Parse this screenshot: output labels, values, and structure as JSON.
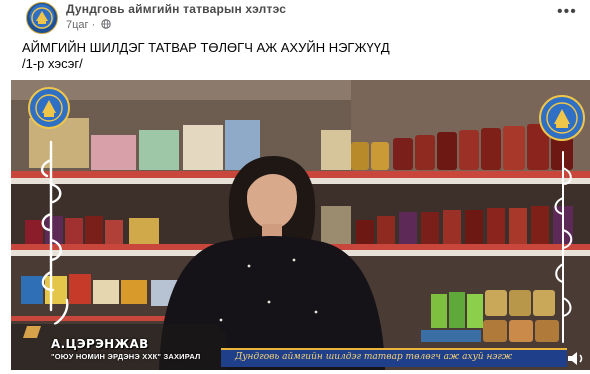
{
  "post": {
    "page_name": "Дундговь аймгийн татварын хэлтэс",
    "time": "7цаг",
    "separator": "·",
    "audience_icon": "globe-icon",
    "menu_icon": "more-icon",
    "more_label": "•••",
    "title": "АЙМГИЙН ШИЛДЭГ ТАТВАР ТӨЛӨГЧ АЖ АХУЙН НЭГЖҮҮД",
    "subtitle": "/1-р хэсэг/"
  },
  "video": {
    "presenter_name": "А.ЦЭРЭНЖАВ",
    "presenter_title": "\"ОЮУ НОМИН ЭРДЭНЭ ХХК\" ЗАХИРАЛ",
    "ticker": "Дундговь аймгийн шилдэг татвар төлөгч аж ахуй нэгж",
    "logo_icons": [
      "tax-emblem-icon",
      "tax-emblem-icon"
    ],
    "script_decorations": [
      "mongolian-script-left",
      "mongolian-script-right"
    ],
    "volume_icon": "volume-icon",
    "colors": {
      "ticker_bg": "#1f3f8a",
      "ticker_border": "#e9b63b",
      "shelf_red": "#c8463c"
    }
  }
}
